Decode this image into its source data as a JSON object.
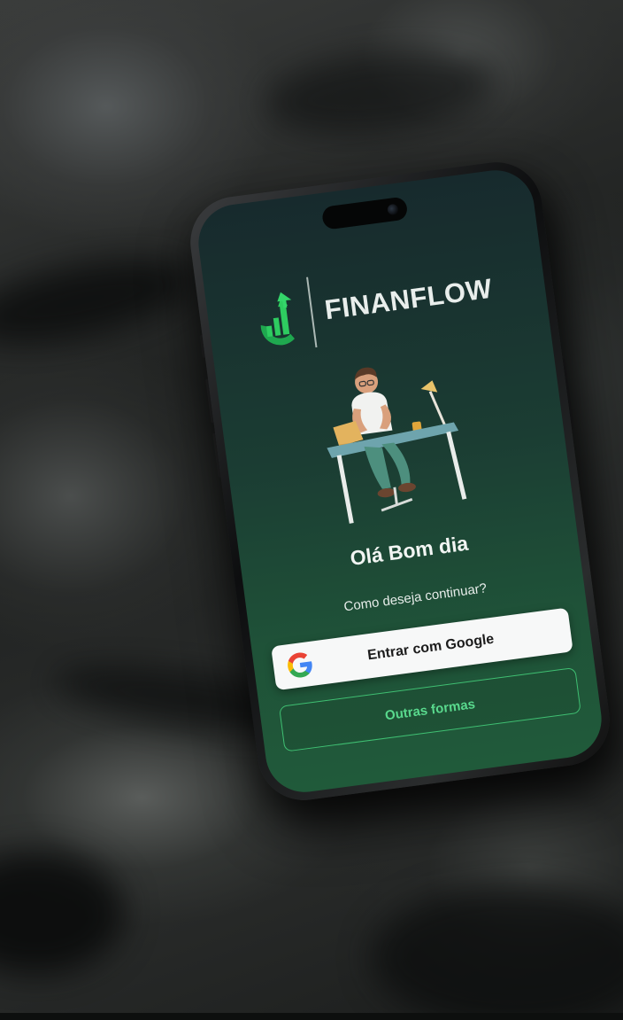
{
  "app": {
    "brand_name": "FINANFLOW"
  },
  "login": {
    "greeting": "Olá Bom dia",
    "prompt": "Como deseja continuar?",
    "google_button_label": "Entrar com Google",
    "other_options_label": "Outras formas"
  },
  "icons": {
    "logo": "growth-chart-logo-icon",
    "google": "google-g-icon",
    "illustration": "person-at-desk-illustration"
  },
  "colors": {
    "brand_green": "#2ecc60",
    "screen_top": "#172a2d",
    "screen_bottom": "#205a3a",
    "outline_green": "#3fbf72",
    "button_white": "#f7f8f8"
  }
}
